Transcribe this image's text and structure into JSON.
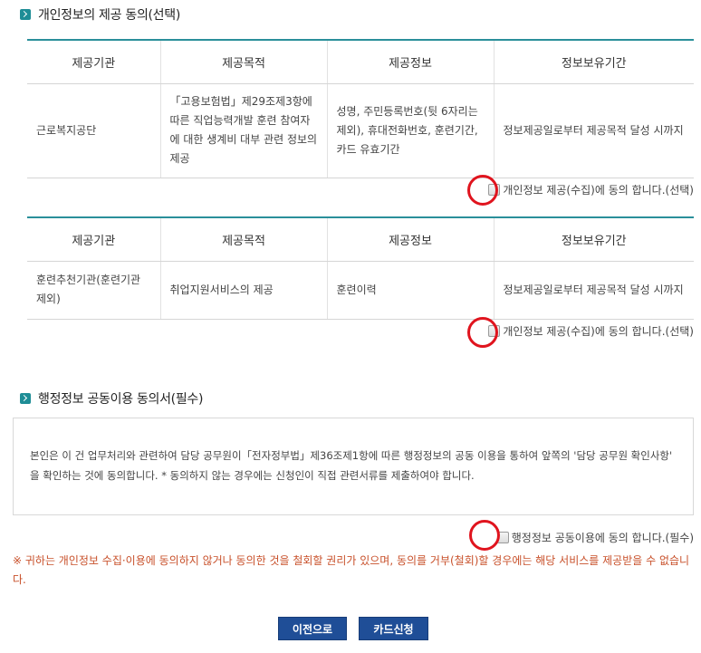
{
  "section1": {
    "title": "개인정보의 제공 동의(선택)",
    "headers": [
      "제공기관",
      "제공목적",
      "제공정보",
      "정보보유기간"
    ],
    "table1": {
      "org": "근로복지공단",
      "purpose": "「고용보험법」제29조제3항에 따른 직업능력개발 훈련 참여자에 대한 생계비 대부 관련 정보의 제공",
      "info": "성명, 주민등록번호(뒷 6자리는 제외), 휴대전화번호, 훈련기간, 카드 유효기간",
      "period": "정보제공일로부터 제공목적 달성 시까지",
      "consent": "개인정보 제공(수집)에 동의 합니다.(선택)"
    },
    "table2": {
      "org": "훈련추천기관(훈련기관 제외)",
      "purpose": "취업지원서비스의 제공",
      "info": "훈련이력",
      "period": "정보제공일로부터 제공목적 달성 시까지",
      "consent": "개인정보 제공(수집)에 동의 합니다.(선택)"
    }
  },
  "section2": {
    "title": "행정정보 공동이용 동의서(필수)",
    "body": "본인은 이 건 업무처리와 관련하여 담당 공무원이「전자정부법」제36조제1항에 따른 행정정보의 공동 이용을 통하여 앞쪽의 '담당 공무원 확인사항' 을 확인하는 것에 동의합니다. * 동의하지 않는 경우에는 신청인이 직접 관련서류를 제출하여야 합니다.",
    "consent": "행정정보 공동이용에 동의 합니다.(필수)"
  },
  "notice": "※ 귀하는 개인정보 수집·이용에 동의하지 않거나 동의한 것을 철회할 권리가 있으며, 동의를 거부(철회)할 경우에는 해당 서비스를 제공받을 수 없습니다.",
  "buttons": {
    "prev": "이전으로",
    "apply": "카드신청"
  },
  "colors": {
    "accent": "#2a8f9a",
    "button": "#1f4e97",
    "notice": "#c8502a",
    "highlight": "#e0141e"
  }
}
